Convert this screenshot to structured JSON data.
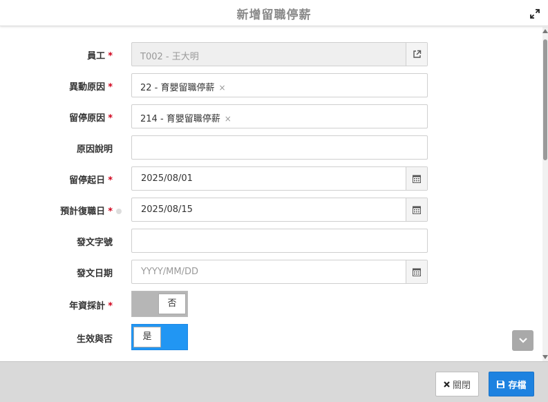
{
  "dialog": {
    "title": "新增留職停薪"
  },
  "fields": {
    "employee": {
      "label": "員工",
      "required": true,
      "value": "T002 - 王大明"
    },
    "change_reason": {
      "label": "異動原因",
      "required": true,
      "value": "22 - 育嬰留職停薪",
      "remove": "×"
    },
    "suspend_reason": {
      "label": "留停原因",
      "required": true,
      "value": "214 - 育嬰留職停薪",
      "remove": "×"
    },
    "reason_desc": {
      "label": "原因說明",
      "value": ""
    },
    "suspend_start": {
      "label": "留停起日",
      "required": true,
      "value": "2025/08/01"
    },
    "expected_return": {
      "label": "預計復職日",
      "required": true,
      "value": "2025/08/15"
    },
    "doc_number": {
      "label": "發文字號",
      "value": ""
    },
    "doc_date": {
      "label": "發文日期",
      "placeholder": "YYYY/MM/DD",
      "value": ""
    },
    "seniority": {
      "label": "年資採計",
      "required": true,
      "value": "否"
    },
    "effective": {
      "label": "生效與否",
      "value": "是"
    }
  },
  "required_mark": "*",
  "footer": {
    "close_label": "關閉",
    "save_label": "存檔"
  },
  "colors": {
    "accent": "#1d82e0",
    "required": "#d0021b",
    "toggle_on": "#2196f3",
    "toggle_off": "#b6b6b6"
  }
}
